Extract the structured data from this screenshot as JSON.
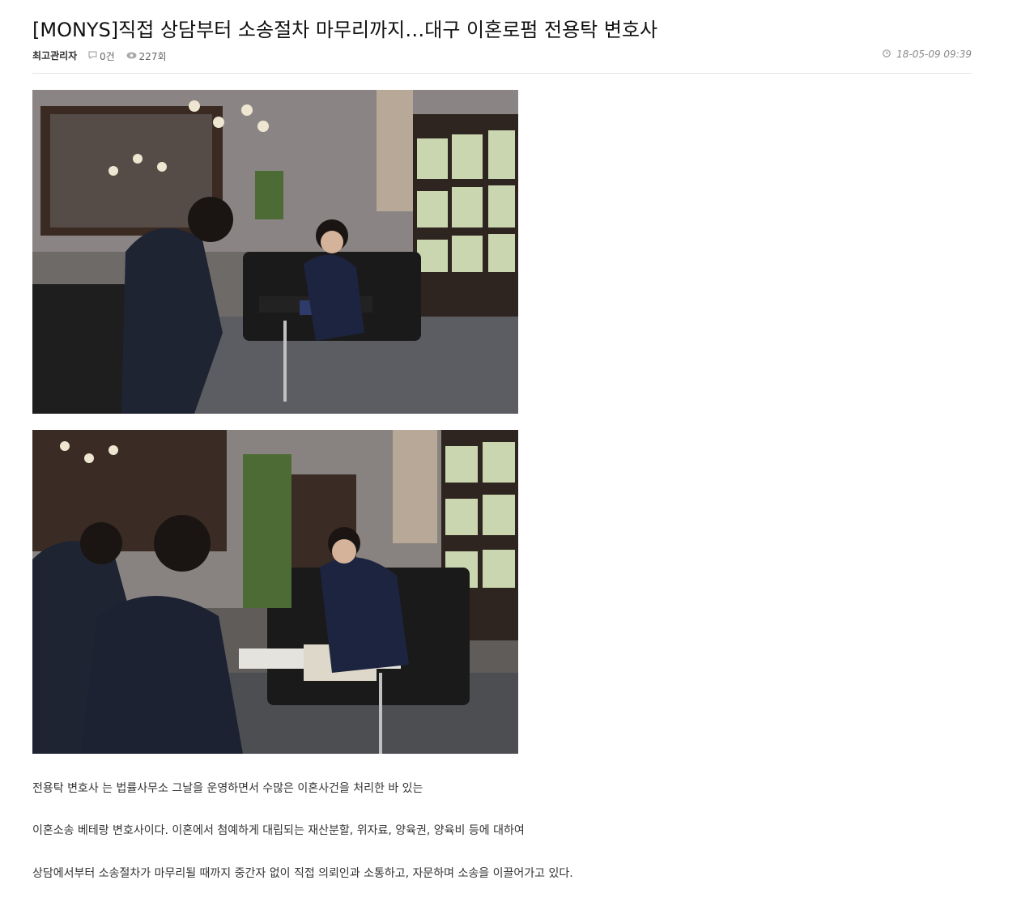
{
  "article": {
    "title": "[MONYS]직접 상담부터 소송절차 마무리까지…대구 이혼로펌 전용탁 변호사",
    "author": "최고관리자",
    "comments": "0건",
    "views": "227회",
    "date": "18-05-09 09:39"
  },
  "icons": {
    "comment": "comment-icon",
    "views": "eye-icon",
    "date": "clock-icon"
  },
  "images": [
    {
      "name": "consultation-photo-1"
    },
    {
      "name": "consultation-photo-2"
    }
  ],
  "body": {
    "paragraphs": [
      "전용탁 변호사 는 법률사무소 그날을 운영하면서 수많은 이혼사건을 처리한 바 있는",
      "이혼소송 베테랑 변호사이다. 이혼에서 첨예하게 대립되는 재산분할, 위자료, 양육권, 양육비 등에 대하여",
      "상담에서부터 소송절차가 마무리될 때까지 중간자 없이 직접 의뢰인과 소통하고, 자문하며 소송을 이끌어가고 있다."
    ]
  },
  "colors": {
    "accent": "#111111",
    "meta": "#888888"
  }
}
